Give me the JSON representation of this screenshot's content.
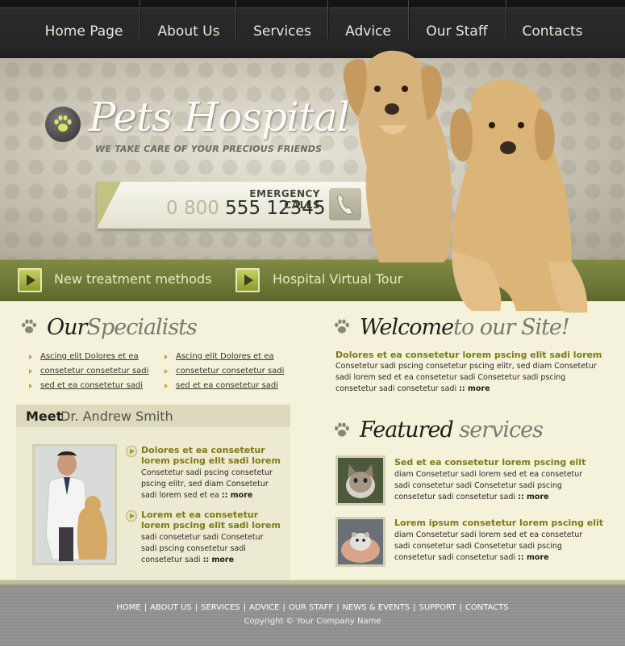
{
  "nav": {
    "items": [
      {
        "label": "Home Page"
      },
      {
        "label": "About Us"
      },
      {
        "label": "Services"
      },
      {
        "label": "Advice"
      },
      {
        "label": "Our Staff"
      },
      {
        "label": "Contacts"
      }
    ]
  },
  "header": {
    "logo_title": "Pets Hospital",
    "tagline": "WE TAKE CARE OF YOUR PRECIOUS FRIENDS",
    "emergency_label": "EMERGENCY CALLS",
    "phone_prefix": "0 800",
    "phone_number": "555 12345"
  },
  "greenbar": {
    "link1": "New treatment methods",
    "link2": "Hospital Virtual Tour"
  },
  "specialists": {
    "title_dark": "Our",
    "title_light": "Specialists",
    "links_col1": [
      "Ascing elit Dolores et ea",
      "consetetur consetetur sadi",
      "sed  et ea consetetur sadi"
    ],
    "links_col2": [
      "Ascing elit Dolores et ea",
      "consetetur consetetur sadi",
      "sed  et ea consetetur sadi"
    ]
  },
  "meet": {
    "label": "Meet",
    "name": "Dr. Andrew Smith",
    "items": [
      {
        "title": "Dolores et ea consetetur lorem pscing elit sadi lorem",
        "text": "Consetetur sadi pscing consetetur pscing elitr, sed diam Consetetur sadi lorem sed  et ea",
        "more": ":: more"
      },
      {
        "title": "Lorem et ea consetetur lorem pscing elit sadi lorem",
        "text": "sadi consetetur sadi Consetetur sadi pscing consetetur sadi consetetur sadi",
        "more": ":: more"
      }
    ]
  },
  "welcome": {
    "title_dark": "Welcome",
    "title_light": "to our Site!",
    "subtitle": "Dolores et ea consetetur lorem pscing elit sadi lorem",
    "text": "Consetetur sadi pscing consetetur pscing elitr, sed diam Consetetur sadi lorem sed  et ea consetetur sadi Consetetur sadi pscing consetetur sadi consetetur sadi",
    "more": ":: more"
  },
  "featured": {
    "title_dark": "Featured",
    "title_light": "services",
    "items": [
      {
        "title": "Sed et ea consetetur lorem pscing elit",
        "text": "diam Consetetur sadi lorem sed  et ea consetetur sadi consetetur sadi Consetetur sadi pscing consetetur sadi consetetur sadi",
        "more": ":: more"
      },
      {
        "title": "Lorem ipsum consetetur lorem pscing elit",
        "text": "diam Consetetur sadi lorem sed  et ea consetetur sadi consetetur sadi Consetetur sadi pscing consetetur sadi consetetur sadi",
        "more": ":: more"
      }
    ]
  },
  "footer": {
    "links": [
      "HOME",
      "ABOUT US",
      "SERVICES",
      "ADVICE",
      "OUR STAFF",
      "NEWS & EVENTS",
      "SUPPORT",
      "CONTACTS"
    ],
    "separator": "|",
    "copyright": "Copyright © Your Company Name"
  },
  "colors": {
    "accent_olive": "#7f7a16",
    "greenbar": "#6d7736",
    "cream": "#f4f2da"
  }
}
